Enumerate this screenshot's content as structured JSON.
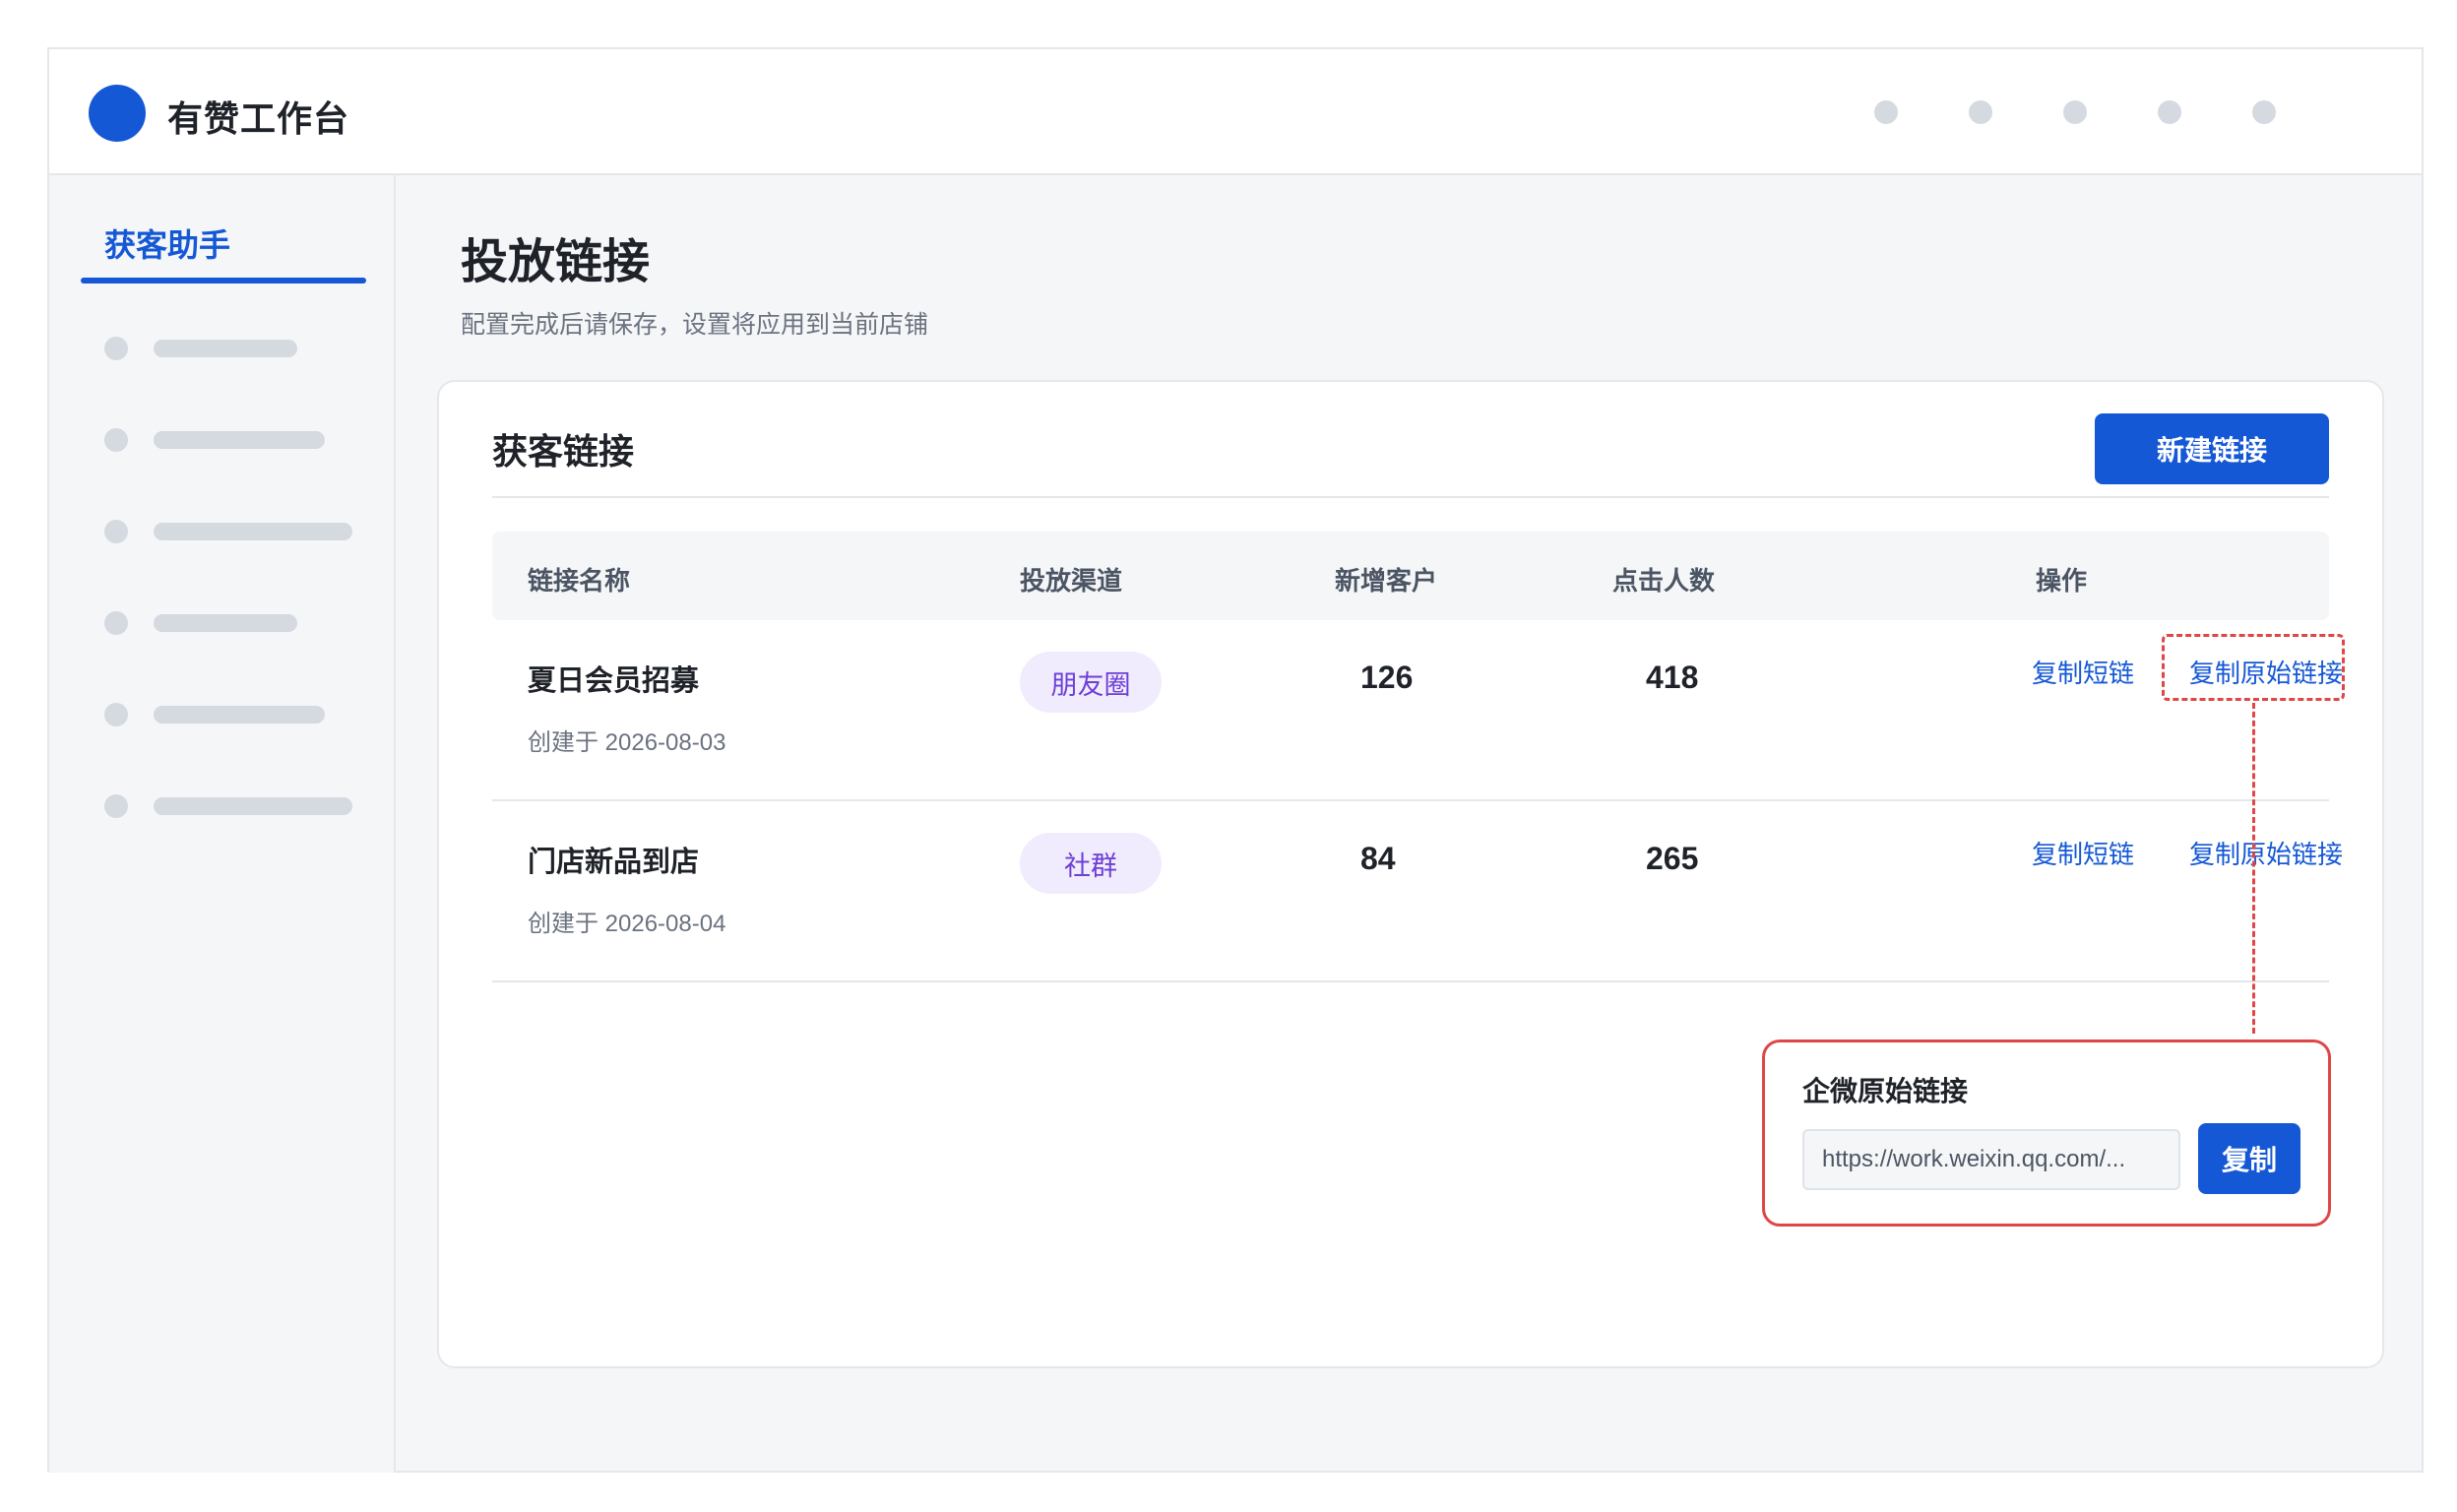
{
  "app": {
    "title": "有赞工作台"
  },
  "sidebar": {
    "active_item": "获客助手"
  },
  "page": {
    "title": "投放链接",
    "subtitle": "配置完成后请保存，设置将应用到当前店铺"
  },
  "card": {
    "title": "获客链接",
    "new_button": "新建链接",
    "columns": [
      "链接名称",
      "投放渠道",
      "新增客户",
      "点击人数",
      "操作"
    ],
    "rows": [
      {
        "name": "夏日会员招募",
        "created": "创建于 2026-08-03",
        "channel": "朋友圈",
        "new_customers": "126",
        "clicks": "418",
        "action_short": "复制短链",
        "action_raw": "复制原始链接"
      },
      {
        "name": "门店新品到店",
        "created": "创建于 2026-08-04",
        "channel": "社群",
        "new_customers": "84",
        "clicks": "265",
        "action_short": "复制短链",
        "action_raw": "复制原始链接"
      }
    ]
  },
  "popup": {
    "title": "企微原始链接",
    "url_value": "https://work.weixin.qq.com/...",
    "copy_button": "复制"
  },
  "colors": {
    "accent": "#1558d6",
    "highlight": "#e14646",
    "tag_bg": "#f1ecfd",
    "tag_text": "#6d3fd6"
  }
}
